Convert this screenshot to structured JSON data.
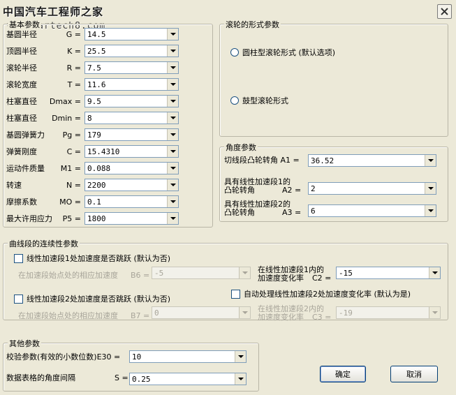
{
  "title": "中国汽车工程师之家",
  "watermark_url": "www.cartech8.com",
  "basic_params": {
    "title": "基本参数",
    "rows": [
      {
        "label": "基圆半径",
        "sym": "G =",
        "value": "14.5"
      },
      {
        "label": "顶圆半径",
        "sym": "K =",
        "value": "25.5"
      },
      {
        "label": "滚轮半径",
        "sym": "R =",
        "value": "7.5"
      },
      {
        "label": "滚轮宽度",
        "sym": "T =",
        "value": "11.6"
      },
      {
        "label": "柱塞直径",
        "sym": "Dmax =",
        "value": "9.5"
      },
      {
        "label": "柱塞直径",
        "sym": "Dmin =",
        "value": "8"
      },
      {
        "label": "基圆弹簧力",
        "sym": "Pg =",
        "value": "179"
      },
      {
        "label": "弹簧刚度",
        "sym": "C =",
        "value": "15.4310"
      },
      {
        "label": "运动件质量",
        "sym": "M1 =",
        "value": "0.088"
      },
      {
        "label": "转速",
        "sym": "N =",
        "value": "2200"
      },
      {
        "label": "摩擦系数",
        "sym": "MO =",
        "value": "0.1"
      },
      {
        "label": "最大许用应力",
        "sym": "P5 =",
        "value": "1800"
      }
    ]
  },
  "roller_form": {
    "title": "滚轮的形式参数",
    "option1": "圆柱型滚轮形式 (默认选项)",
    "option2": "鼓型滚轮形式"
  },
  "angle_params": {
    "title": "角度参数",
    "a1_label": "切线段凸轮转角 A1 =",
    "a1_value": "36.52",
    "a2_label1": "具有线性加速段1的",
    "a2_label2": "凸轮转角",
    "a2_sym": "A2 =",
    "a2_value": "2",
    "a3_label1": "具有线性加速段2的",
    "a3_label2": "凸轮转角",
    "a3_sym": "A3 =",
    "a3_value": "6"
  },
  "continuity": {
    "title": "曲线段的连续性参数",
    "check1": "线性加速段1处加速度是否跳跃 (默认为否)",
    "b6_label": "在加速段始点处的相应加速度",
    "b6_sym": "B6 =",
    "b6_value": "-5",
    "c2_label1": "在线性加速段1内的",
    "c2_label2": "加速度变化率",
    "c2_sym": "C2 =",
    "c2_value": "-15",
    "check2": "线性加速段2处加速度是否跳跃 (默认为否)",
    "auto_check": "自动处理线性加速段2处加速度变化率 (默认为是)",
    "b7_label": "在加速段始点处的相应加速度",
    "b7_sym": "B7 =",
    "b7_value": "0",
    "c3_label1": "在线性加速段2内的",
    "c3_label2": "加速度变化率",
    "c3_sym": "C3 =",
    "c3_value": "-19"
  },
  "other_params": {
    "title": "其他参数",
    "e30_label": "校验参数(有效的小数位数)E30 =",
    "e30_value": "10",
    "s_label": "数据表格的角度间隔",
    "s_sym": "S =",
    "s_value": "0.25"
  },
  "buttons": {
    "ok": "确定",
    "cancel": "取消"
  }
}
